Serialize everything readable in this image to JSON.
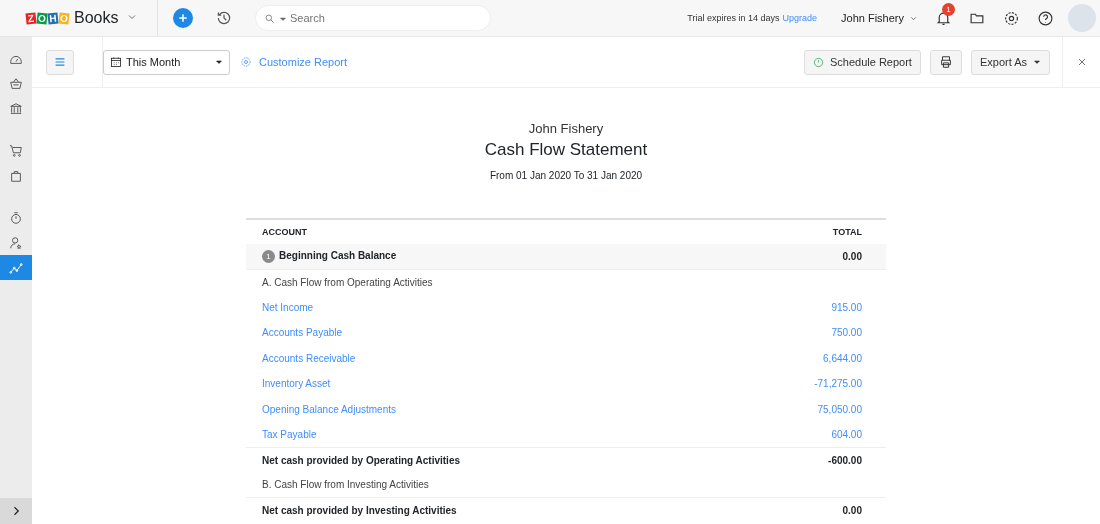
{
  "topbar": {
    "logo_letters": [
      {
        "text": "Z",
        "color": "#e42527"
      },
      {
        "text": "O",
        "color": "#089949"
      },
      {
        "text": "H",
        "color": "#226db4"
      },
      {
        "text": "O",
        "color": "#f9b21d"
      }
    ],
    "product": "Books",
    "search": {
      "placeholder": "Search"
    },
    "trial": "Trial expires in 14 days",
    "upgrade": "Upgrade",
    "user": "John Fishery",
    "notifications": "1"
  },
  "sidebar": {
    "groups": [
      [
        {
          "kind": "dashboard",
          "selected": false
        },
        {
          "kind": "basket",
          "selected": false
        },
        {
          "kind": "bank",
          "selected": false
        }
      ],
      [
        {
          "kind": "cart",
          "selected": false
        },
        {
          "kind": "bag",
          "selected": false
        }
      ],
      [
        {
          "kind": "timer",
          "selected": false
        },
        {
          "kind": "user",
          "selected": false
        },
        {
          "kind": "chart",
          "selected": true
        }
      ]
    ]
  },
  "toolbar": {
    "period": "This Month",
    "customize": "Customize Report",
    "schedule": "Schedule Report",
    "export": "Export As"
  },
  "report": {
    "company": "John Fishery",
    "title": "Cash Flow Statement",
    "range": "From 01 Jan 2020 To 31 Jan 2020",
    "columns": [
      "ACCOUNT",
      "TOTAL"
    ],
    "rows": [
      {
        "kind": "opening",
        "badge": "1",
        "account": "Beginning Cash Balance",
        "total": "0.00"
      },
      {
        "kind": "section",
        "account": "A. Cash Flow from Operating Activities"
      },
      {
        "kind": "account",
        "account": "Net Income",
        "total": "915.00"
      },
      {
        "kind": "account",
        "account": "Accounts Payable",
        "total": "750.00"
      },
      {
        "kind": "account",
        "account": "Accounts Receivable",
        "total": "6,644.00"
      },
      {
        "kind": "account",
        "account": "Inventory Asset",
        "total": "-71,275.00"
      },
      {
        "kind": "account",
        "account": "Opening Balance Adjustments",
        "total": "75,050.00"
      },
      {
        "kind": "account",
        "account": "Tax Payable",
        "total": "604.00"
      },
      {
        "kind": "total",
        "account": "Net cash provided by Operating Activities",
        "total": "-600.00"
      },
      {
        "kind": "section",
        "account": "B. Cash Flow from Investing Activities"
      },
      {
        "kind": "total",
        "account": "Net cash provided by Investing Activities",
        "total": "0.00"
      }
    ]
  }
}
